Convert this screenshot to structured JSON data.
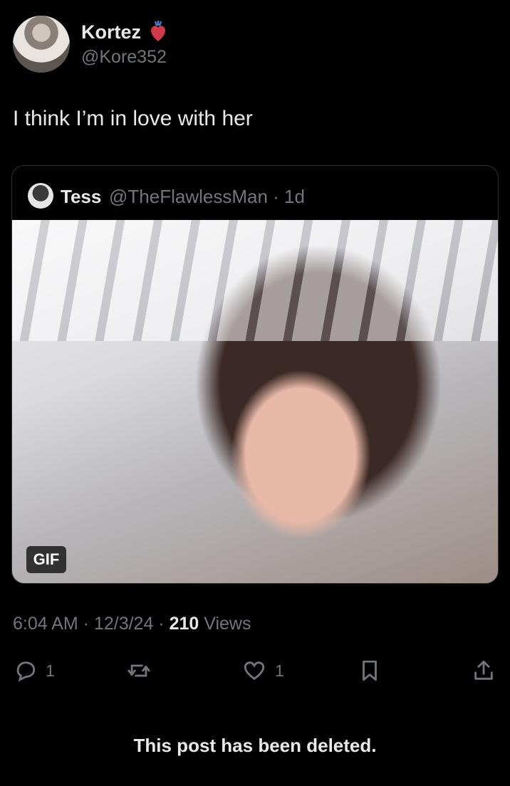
{
  "author": {
    "name": "Kortez",
    "handle": "@Kore352",
    "badge_icon": "anatomical-heart-emoji"
  },
  "tweet": {
    "text": "I think I’m in love with her"
  },
  "quote": {
    "name": "Tess",
    "handle_time": "@TheFlawlessMan · 1d",
    "media_badge": "GIF"
  },
  "meta": {
    "time_date": "6:04 AM · 12/3/24 · ",
    "views_count": "210",
    "views_label": "Views"
  },
  "actions": {
    "replies": "1",
    "likes": "1"
  },
  "footer": {
    "deleted_notice": "This post has been deleted."
  },
  "colors": {
    "background": "#000000",
    "text": "#e7e9ea",
    "muted": "#71767b",
    "border": "#2f3336"
  }
}
